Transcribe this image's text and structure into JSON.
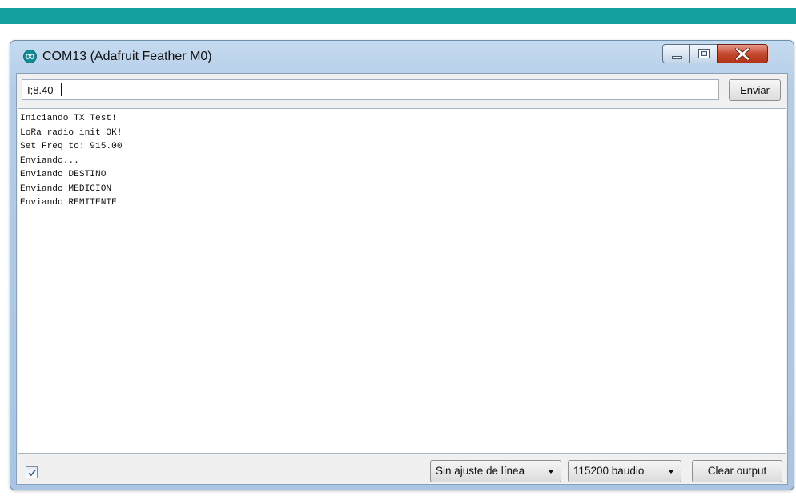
{
  "window": {
    "title": "COM13 (Adafruit Feather M0)",
    "app_icon": "arduino-infinity-icon",
    "controls": {
      "minimize": "minimize-icon",
      "maximize": "maximize-icon",
      "close": "close-icon"
    }
  },
  "send_bar": {
    "input_value": "I;8.40",
    "send_label": "Enviar"
  },
  "output": {
    "lines": [
      "Iniciando TX Test!",
      "LoRa radio init OK!",
      "Set Freq to: 915.00",
      "Enviando...",
      "Enviando DESTINO",
      "Enviando MEDICION",
      "Enviando REMITENTE"
    ]
  },
  "footer": {
    "autoscroll_checked": true,
    "line_ending": {
      "selected": "Sin ajuste de línea"
    },
    "baud_rate": {
      "selected": "115200 baudio"
    },
    "clear_label": "Clear output"
  },
  "colors": {
    "banner": "#149fa0",
    "window_frame": "#b4cde6",
    "close_button": "#c34a30"
  }
}
